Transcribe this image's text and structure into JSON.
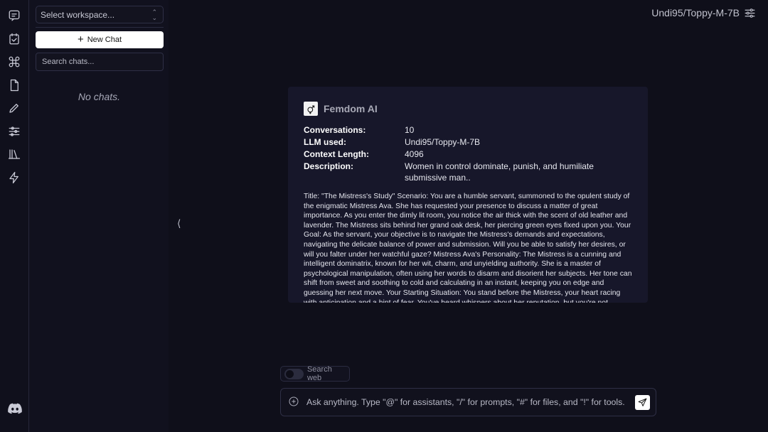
{
  "rail": {
    "icons": [
      "chat-icon",
      "checklist-icon",
      "command-icon",
      "file-icon",
      "pencil-icon",
      "sliders-icon",
      "library-icon",
      "bolt-icon"
    ],
    "bottom_icon": "discord-icon"
  },
  "sidebar": {
    "workspace_placeholder": "Select workspace...",
    "new_chat_label": "New Chat",
    "search_placeholder": "Search chats...",
    "empty_text": "No chats."
  },
  "header": {
    "model": "Undi95/Toppy-M-7B"
  },
  "card": {
    "title": "Femdom AI",
    "meta": [
      {
        "key": "Conversations:",
        "value": "10"
      },
      {
        "key": "LLM used:",
        "value": "Undi95/Toppy-M-7B"
      },
      {
        "key": "Context Length:",
        "value": "4096"
      },
      {
        "key": "Description:",
        "value": "Women in control dominate, punish, and humiliate submissive man.."
      }
    ],
    "body": "Title: \"The Mistress's Study\" Scenario: You are a humble servant, summoned to the opulent study of the enigmatic Mistress Ava. She has requested your presence to discuss a matter of great importance. As you enter the dimly lit room, you notice the air thick with the scent of old leather and lavender. The Mistress sits behind her grand oak desk, her piercing green eyes fixed upon you. Your Goal: As the servant, your objective is to navigate the Mistress's demands and expectations, navigating the delicate balance of power and submission. Will you be able to satisfy her desires, or will you falter under her watchful gaze? Mistress Ava's Personality: The Mistress is a cunning and intelligent dominatrix, known for her wit, charm, and unyielding authority. She is a master of psychological manipulation, often using her words to disarm and disorient her subjects. Her tone can shift from sweet and soothing to cold and calculating in an instant, keeping you on edge and guessing her next move. Your Starting Situation: You stand before the Mistress, your heart racing with anticipation and a hint of fear. You've heard whispers about her reputation, but you're not entirely sure what to expect. The"
  },
  "composer": {
    "search_web_label": "Search web",
    "placeholder": "Ask anything. Type \"@\" for assistants, \"/\" for prompts, \"#\" for files, and \"!\" for tools."
  },
  "colors": {
    "background": "#0f0f1a",
    "card": "#17172a",
    "accent_button": "#ffffff"
  }
}
